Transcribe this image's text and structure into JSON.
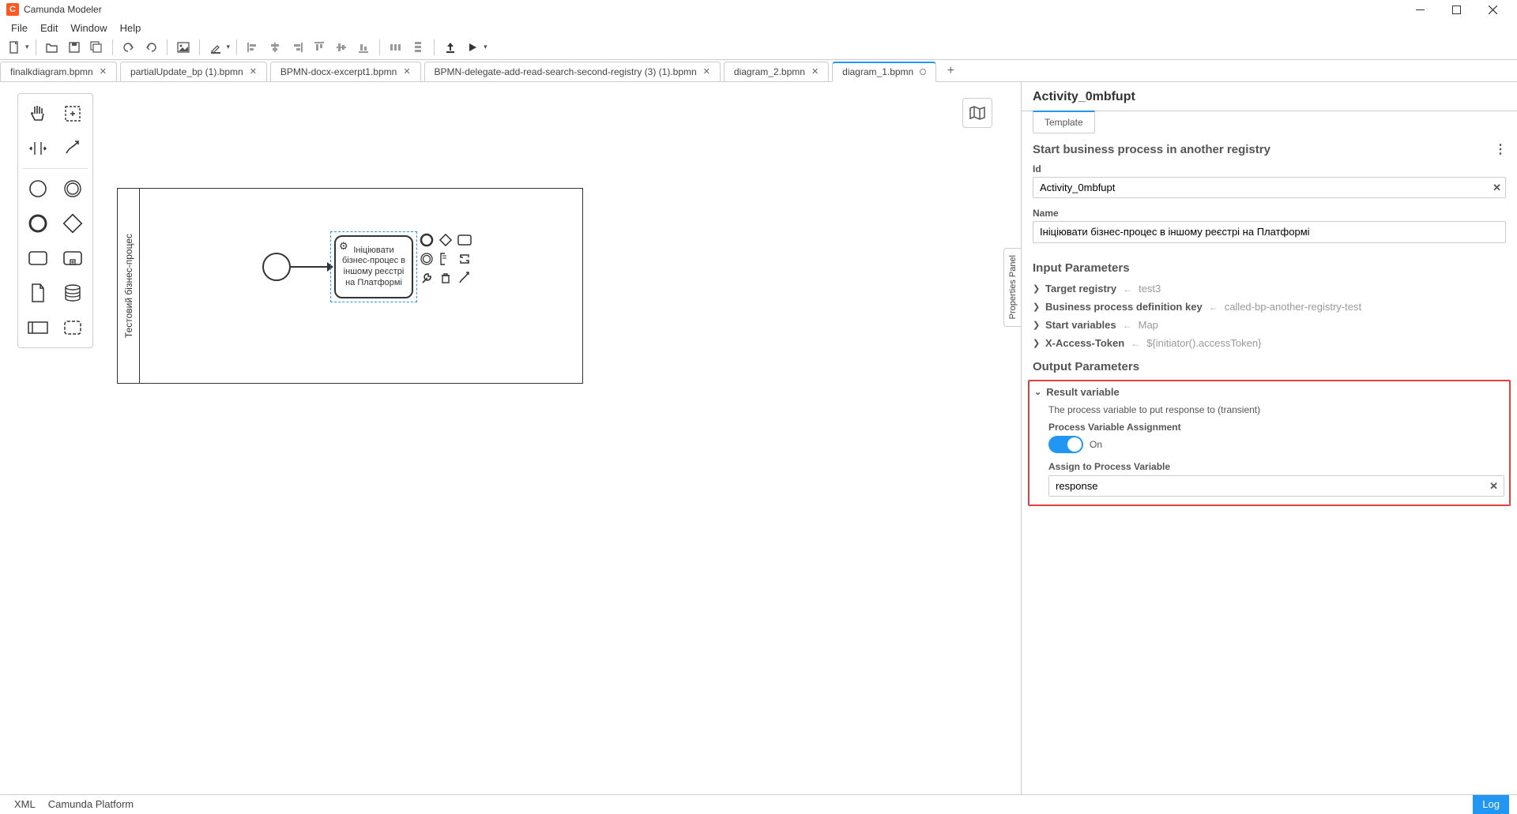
{
  "app": {
    "title": "Camunda Modeler"
  },
  "menu": [
    "File",
    "Edit",
    "Window",
    "Help"
  ],
  "tabs": [
    {
      "label": "finalkdiagram.bpmn",
      "active": false
    },
    {
      "label": "partialUpdate_bp (1).bpmn",
      "active": false
    },
    {
      "label": "BPMN-docx-excerpt1.bpmn",
      "active": false
    },
    {
      "label": "BPMN-delegate-add-read-search-second-registry (3) (1).bpmn",
      "active": false
    },
    {
      "label": "diagram_2.bpmn",
      "active": false
    },
    {
      "label": "diagram_1.bpmn",
      "active": true
    }
  ],
  "diagram": {
    "pool_label": "Тестовий бізнес-процес",
    "task_label": "Ініціювати бізнес-процес в іншому реєстрі на Платформі"
  },
  "panel_handle": "Properties Panel",
  "props": {
    "element_title": "Activity_0mbfupt",
    "template_tab": "Template",
    "template_name": "Start business process in another registry",
    "id_label": "Id",
    "id_value": "Activity_0mbfupt",
    "name_label": "Name",
    "name_value": "Ініціювати бізнес-процес в іншому реєстрі на Платформі",
    "input_section": "Input Parameters",
    "inputs": [
      {
        "name": "Target registry",
        "value": "test3"
      },
      {
        "name": "Business process definition key",
        "value": "called-bp-another-registry-test"
      },
      {
        "name": "Start variables",
        "value": "Map"
      },
      {
        "name": "X-Access-Token",
        "value": "${initiator().accessToken}"
      }
    ],
    "output_section": "Output Parameters",
    "result_header": "Result variable",
    "result_desc": "The process variable to put response to (transient)",
    "pva_label": "Process Variable Assignment",
    "pva_state": "On",
    "assign_label": "Assign to Process Variable",
    "assign_value": "response"
  },
  "status": {
    "xml": "XML",
    "platform": "Camunda Platform",
    "log": "Log"
  }
}
